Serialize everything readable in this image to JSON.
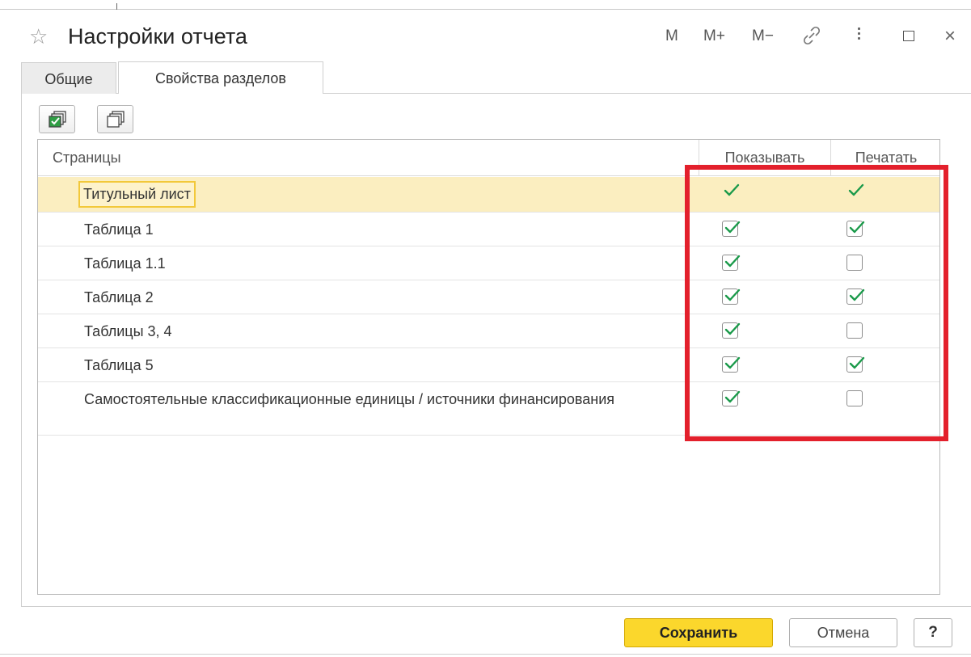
{
  "window": {
    "title": "Настройки отчета",
    "toolbar": {
      "m": "M",
      "m_plus": "M+",
      "m_minus": "M−",
      "close": "×"
    }
  },
  "tabs": [
    {
      "label": "Общие",
      "active": false
    },
    {
      "label": "Свойства разделов",
      "active": true
    }
  ],
  "toolbar_icons": [
    "check-all-icon",
    "uncheck-all-icon"
  ],
  "table": {
    "columns": {
      "pages": "Страницы",
      "show": "Показывать",
      "print": "Печатать"
    },
    "rows": [
      {
        "label": "Титульный лист",
        "show": true,
        "print": true,
        "selected": true
      },
      {
        "label": "Таблица 1",
        "show": true,
        "print": true
      },
      {
        "label": "Таблица 1.1",
        "show": true,
        "print": false
      },
      {
        "label": "Таблица 2",
        "show": true,
        "print": true
      },
      {
        "label": "Таблицы 3, 4",
        "show": true,
        "print": false
      },
      {
        "label": "Таблица 5",
        "show": true,
        "print": true
      },
      {
        "label": "Самостоятельные классификационные единицы / источники финансирования",
        "show": true,
        "print": false
      }
    ]
  },
  "footer": {
    "save": "Сохранить",
    "cancel": "Отмена",
    "help": "?"
  },
  "colors": {
    "accent": "#fbd72c",
    "check": "#1a9a4a",
    "highlight": "#e3202c",
    "selected_row": "#fbeec0"
  }
}
